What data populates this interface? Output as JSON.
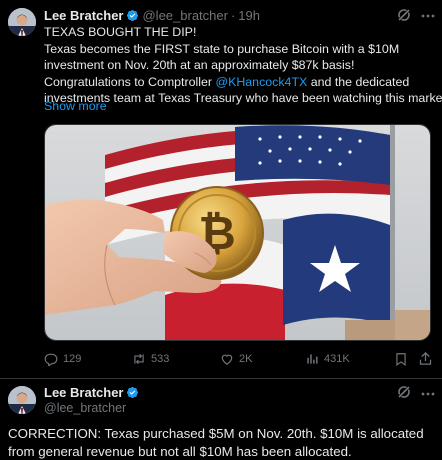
{
  "tweet": {
    "author_name": "Lee Bratcher",
    "handle": "@lee_bratcher",
    "separator": "·",
    "time": "19h",
    "lines": [
      "TEXAS BOUGHT THE DIP!",
      "Texas becomes the FIRST state to purchase Bitcoin with a $10M",
      "investment on Nov. 20th at an approximately $87k basis!"
    ],
    "line4_before": "Congratulations to Comptroller ",
    "line4_mention": "@KHancock4TX",
    "line4_after": " and the dedicated",
    "line5": "investments team at Texas Treasury who have been watching this market",
    "show_more": "Show more",
    "media_icon": "hand-holding-bitcoin-with-us-and-texas-flags-photo",
    "stats": {
      "replies": "129",
      "reposts": "533",
      "likes": "2K",
      "views": "431K"
    }
  },
  "reply": {
    "author_name": "Lee Bratcher",
    "handle": "@lee_bratcher",
    "lines": [
      "CORRECTION: Texas purchased $5M on Nov. 20th. $10M is allocated",
      "from general revenue but not all $10M has been allocated."
    ]
  },
  "colors": {
    "background": "#000000",
    "text": "#e7e9ea",
    "secondary": "#71767b",
    "accent": "#1d9bf0",
    "divider": "#2f3336"
  }
}
